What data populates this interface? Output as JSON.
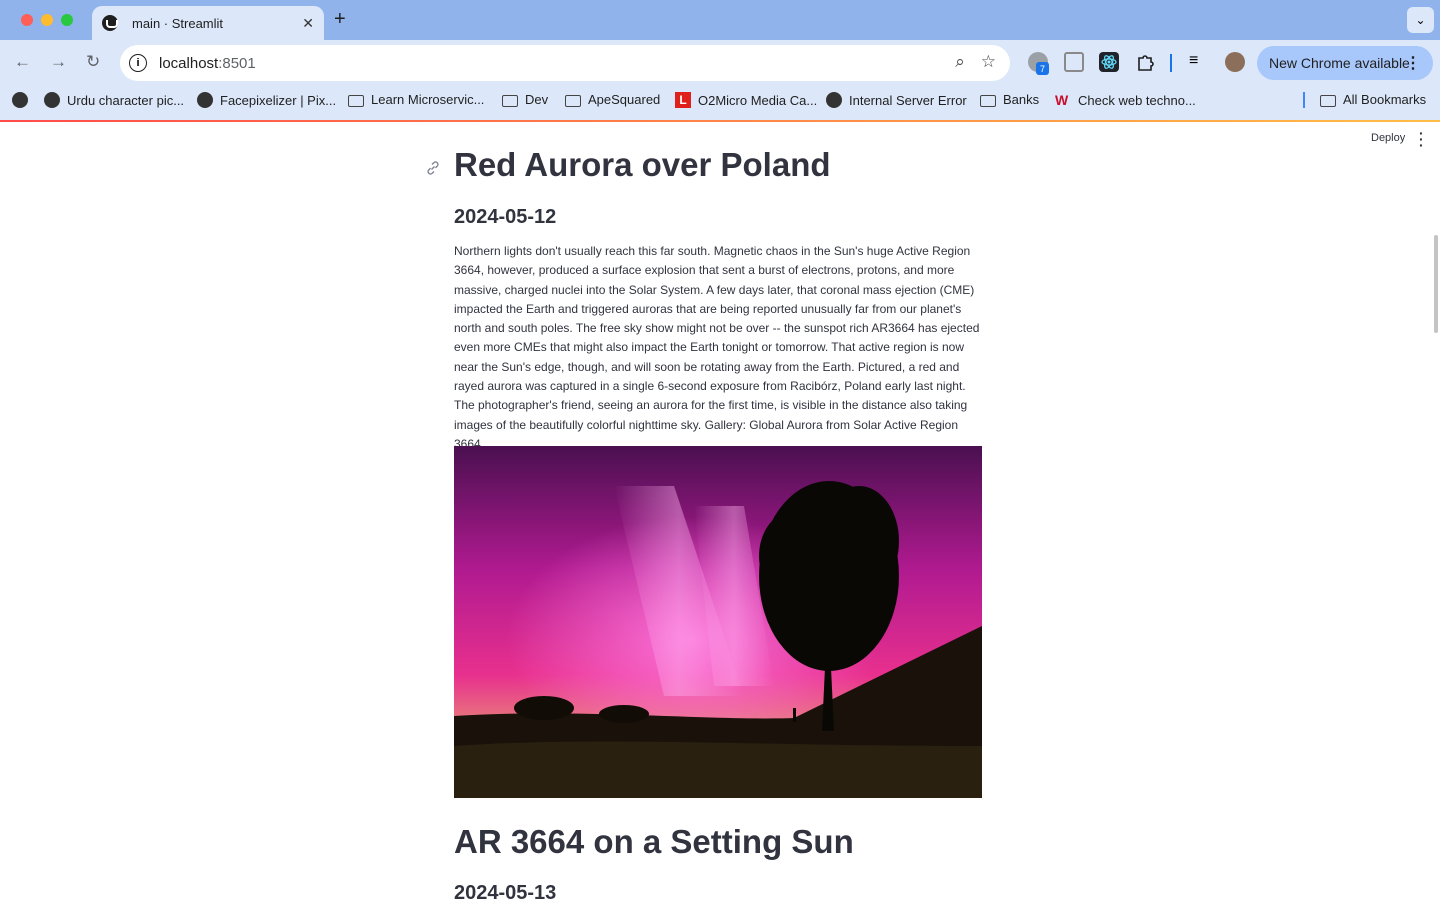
{
  "browser": {
    "tab_title": "main · Streamlit",
    "url_host": "localhost",
    "url_port": ":8501",
    "update_button": "New Chrome available",
    "extension_badge": "7",
    "bookmarks": [
      {
        "label": "Urdu character pic...",
        "icon": "globe-icon"
      },
      {
        "label": "Facepixelizer | Pix...",
        "icon": "globe-icon"
      },
      {
        "label": "Learn Microservic...",
        "icon": "folder-icon"
      },
      {
        "label": "Dev",
        "icon": "folder-icon"
      },
      {
        "label": "ApeSquared",
        "icon": "folder-icon"
      },
      {
        "label": "O2Micro Media Ca...",
        "icon": "l-logo-icon"
      },
      {
        "label": "Internal Server Error",
        "icon": "globe-icon"
      },
      {
        "label": "Banks",
        "icon": "folder-icon"
      },
      {
        "label": "Check web techno...",
        "icon": "w-logo-icon"
      }
    ],
    "all_bookmarks": "All Bookmarks",
    "accent_colors": [
      "#ff4b4b",
      "#ffbd45"
    ]
  },
  "app": {
    "deploy_label": "Deploy",
    "entries": [
      {
        "title": "Red Aurora over Poland",
        "date": "2024-05-12",
        "explanation": "Northern lights don't usually reach this far south. Magnetic chaos in the Sun's huge Active Region 3664, however, produced a surface explosion that sent a burst of electrons, protons, and more massive, charged nuclei into the Solar System. A few days later, that coronal mass ejection (CME) impacted the Earth and triggered auroras that are being reported unusually far from our planet's north and south poles. The free sky show might not be over -- the sunspot rich AR3664 has ejected even more CMEs that might also impact the Earth tonight or tomorrow. That active region is now near the Sun's edge, though, and will soon be rotating away from the Earth. Pictured, a red and rayed aurora was captured in a single 6-second exposure from Racibórz, Poland early last night. The photographer's friend, seeing an aurora for the first time, is visible in the distance also taking images of the beautifully colorful nighttime sky. Gallery: Global Aurora from Solar Active Region 3664"
      },
      {
        "title": "AR 3664 on a Setting Sun",
        "date": "2024-05-13"
      }
    ]
  }
}
